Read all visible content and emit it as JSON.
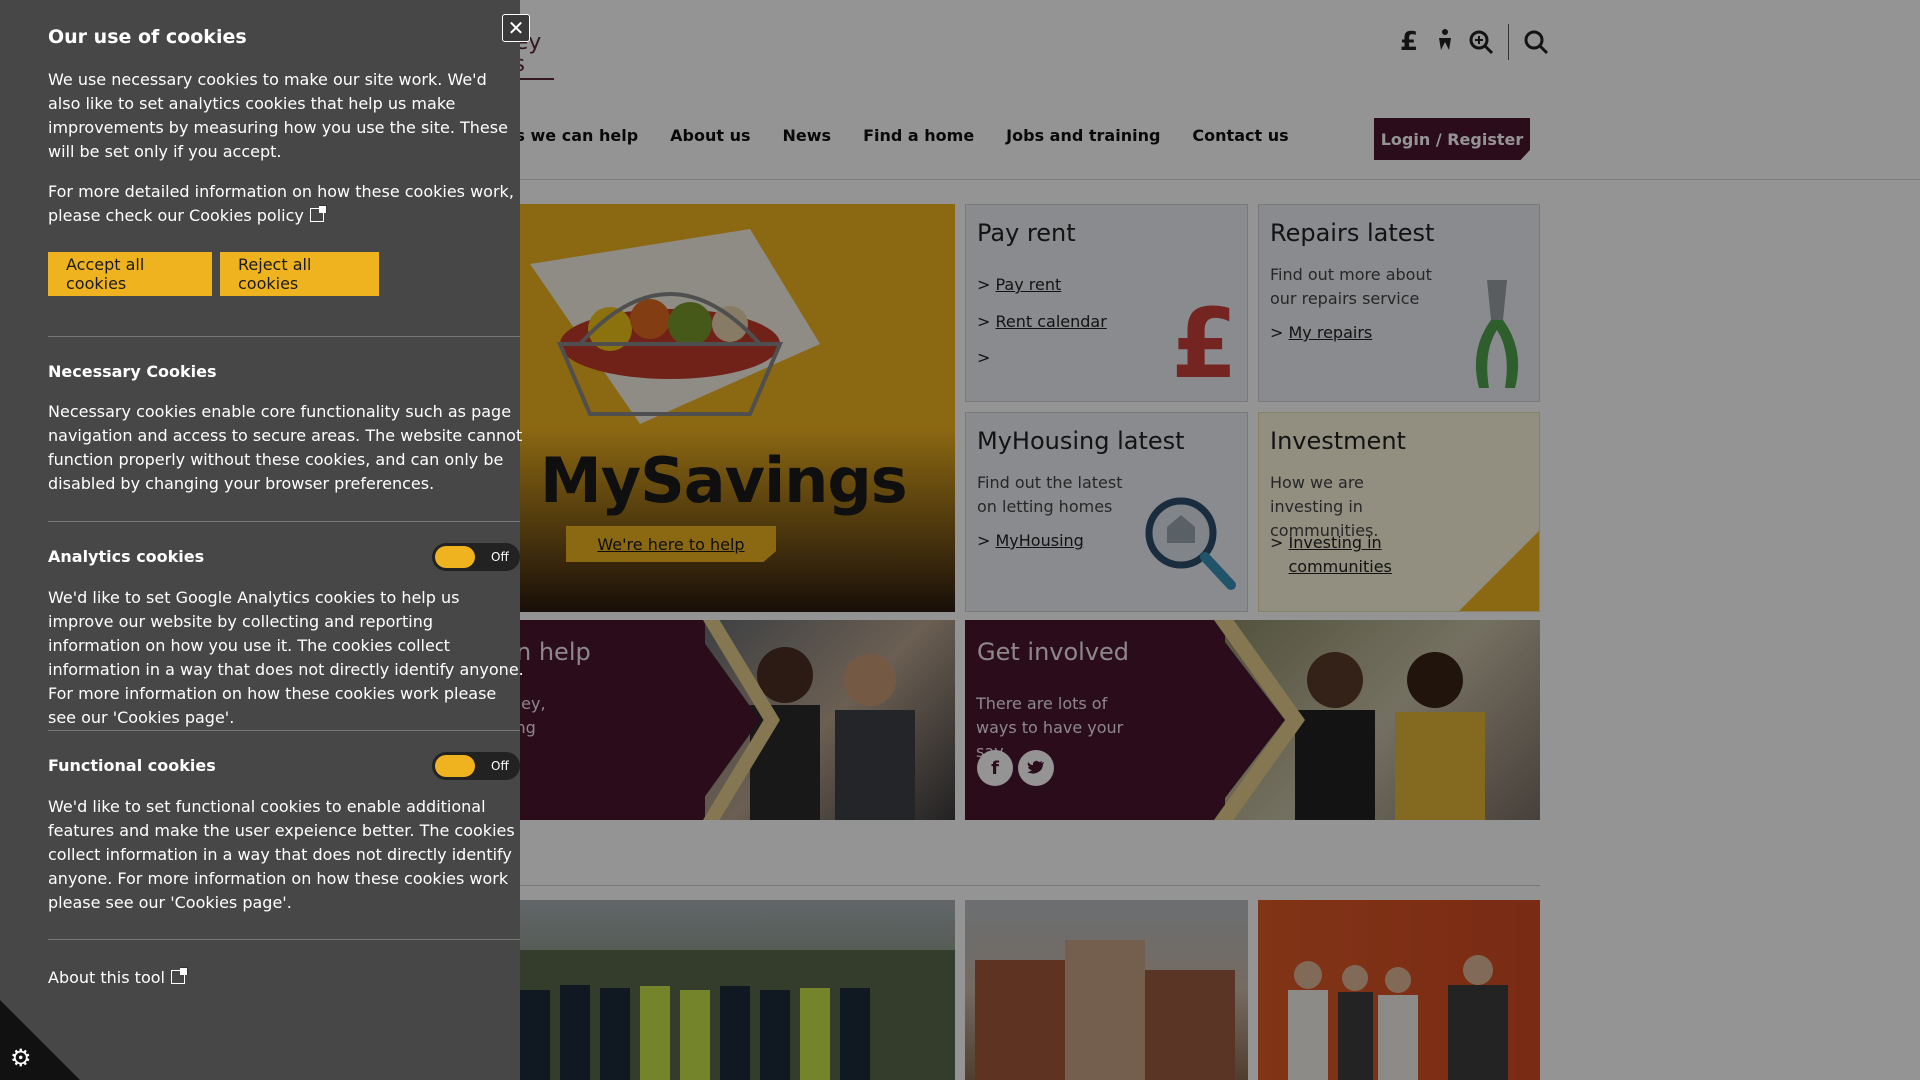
{
  "header": {
    "logo_text_top": "tley",
    "logo_text_bottom": "es",
    "icons": [
      "pound-icon",
      "accessibility-icon",
      "zoom-icon",
      "search-icon"
    ],
    "icon_glyphs": [
      "£",
      "♿",
      "⊕",
      "🔍"
    ],
    "nav": [
      "ys we can help",
      "About us",
      "News",
      "Find a home",
      "Jobs and training",
      "Contact us"
    ],
    "login_label": "Login / Register"
  },
  "promo": {
    "title": "MySavings",
    "button": "We're here to help"
  },
  "tiles": {
    "pay_rent": {
      "title": "Pay rent",
      "links": [
        "Pay rent",
        "Rent calendar",
        ""
      ]
    },
    "repairs": {
      "title": "Repairs latest",
      "desc": "Find out more about our repairs service",
      "link": "My repairs"
    },
    "myhousing": {
      "title": "MyHousing latest",
      "desc": "Find out the latest on letting homes",
      "link": "MyHousing"
    },
    "investment": {
      "title": "Investment",
      "desc": "How we are investing in communities.",
      "link": "Investing in communities"
    },
    "help": {
      "title": "n help",
      "desc1": "ney,",
      "desc2": "ing"
    },
    "involved": {
      "title": "Get involved",
      "desc": "There are lots of ways to have your say"
    }
  },
  "cookie": {
    "title": "Our use of cookies",
    "intro": "We use necessary cookies to make our site work. We'd also like to set analytics cookies that help us make improvements by measuring how you use the site. These will be set only if you accept.",
    "more_info": "For more detailed information on how these cookies work, please check our Cookies policy",
    "accept_label": "Accept all cookies",
    "reject_label": "Reject all cookies",
    "necessary_title": "Necessary Cookies",
    "necessary_text": "Necessary cookies enable core functionality such as page navigation and access to secure areas. The website cannot function properly without these cookies, and can only be disabled by changing your browser preferences.",
    "analytics_title": "Analytics cookies",
    "analytics_toggle": "Off",
    "analytics_text": "We'd like to set Google Analytics cookies to help us improve our website by collecting and reporting information on how you use it. The cookies collect information in a way that does not directly identify anyone. For more information on how these cookies work please see our 'Cookies page'.",
    "functional_title": "Functional cookies",
    "functional_toggle": "Off",
    "functional_text": "We'd like to set functional cookies to enable additional features and make the user expeience better. The cookies collect information in a way that does not directly identify anyone. For more information on how these cookies work please see our 'Cookies page'.",
    "about_tool": "About this tool",
    "close_glyph": "✕",
    "gear_glyph": "⚙"
  },
  "colors": {
    "accent_yellow": "#f0b320",
    "brand_maroon": "#4a1530",
    "panel_bg": "#ffffff"
  }
}
